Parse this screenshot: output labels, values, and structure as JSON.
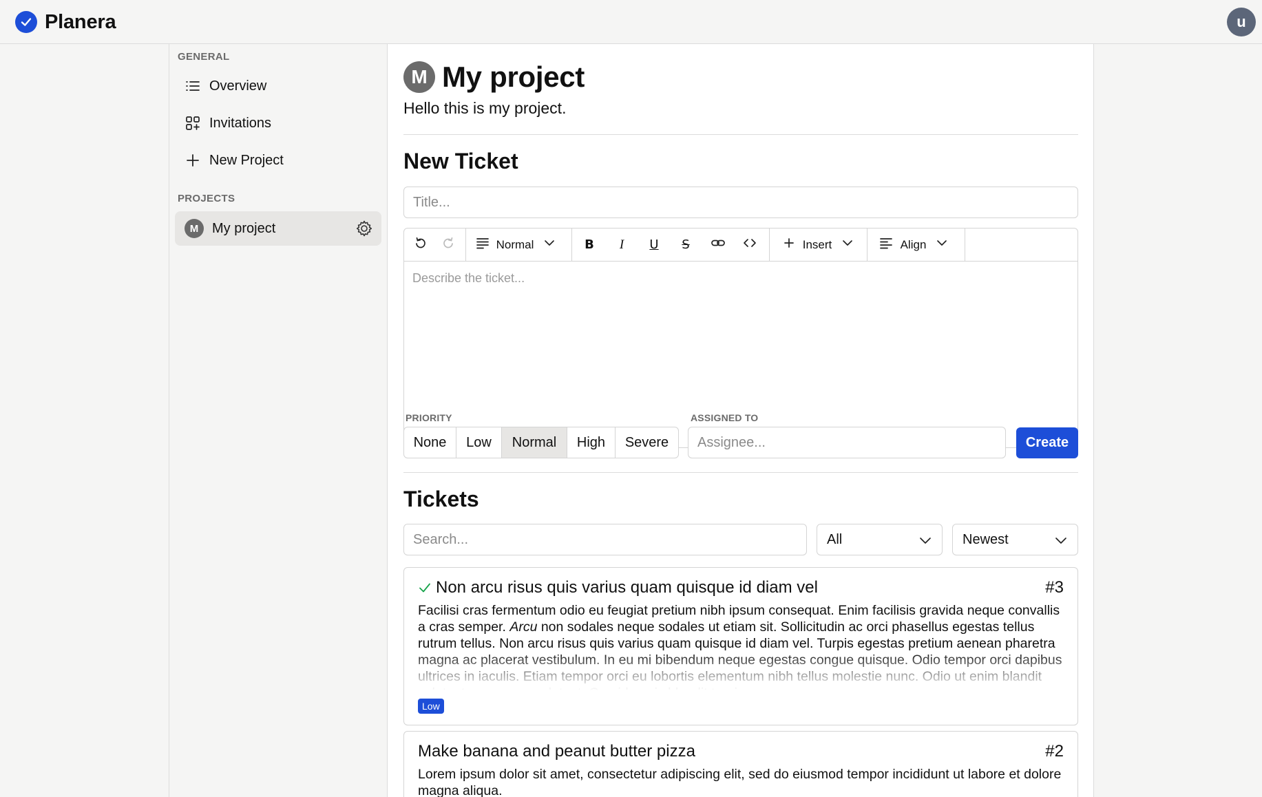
{
  "app": {
    "name": "Planera",
    "user_initial": "u"
  },
  "sidebar": {
    "general_heading": "GENERAL",
    "items": [
      {
        "label": "Overview",
        "icon": "list-icon"
      },
      {
        "label": "Invitations",
        "icon": "grid-plus-icon"
      },
      {
        "label": "New Project",
        "icon": "plus-icon"
      }
    ],
    "projects_heading": "PROJECTS",
    "projects": [
      {
        "initial": "M",
        "label": "My project",
        "active": true
      }
    ]
  },
  "project": {
    "initial": "M",
    "title": "My project",
    "description": "Hello this is my project."
  },
  "new_ticket": {
    "heading": "New Ticket",
    "title_placeholder": "Title...",
    "toolbar": {
      "block_type": "Normal",
      "insert_label": "Insert",
      "align_label": "Align"
    },
    "description_placeholder": "Describe the ticket...",
    "priority_label": "PRIORITY",
    "priorities": [
      "None",
      "Low",
      "Normal",
      "High",
      "Severe"
    ],
    "selected_priority": "Normal",
    "assigned_label": "ASSIGNED TO",
    "assignee_placeholder": "Assignee...",
    "create_label": "Create"
  },
  "tickets": {
    "heading": "Tickets",
    "search_placeholder": "Search...",
    "filter_value": "All",
    "sort_value": "Newest",
    "items": [
      {
        "done": true,
        "title": "Non arcu risus quis varius quam quisque id diam vel",
        "number": "#3",
        "body_part1": "Facilisi cras fermentum odio eu feugiat pretium nibh ipsum consequat. Enim facilisis gravida neque convallis a cras semper. ",
        "body_italic": "Arcu",
        "body_part2": " non sodales neque sodales ut etiam sit. Sollicitudin ac orci phasellus egestas tellus rutrum tellus. Non arcu risus quis varius quam quisque id diam vel. Turpis egestas pretium aenean pharetra magna ac placerat vestibulum. In eu mi bibendum neque egestas congue quisque. Odio tempor orci dapibus ultrices in iaculis. Etiam tempor orci eu lobortis elementum nibh tellus molestie nunc. Odio ut enim blandit volutpat maecenas volutpat. Gravida quis blandit turpis.",
        "priority": "Low"
      },
      {
        "done": false,
        "title": "Make banana and peanut butter pizza",
        "number": "#2",
        "body": "Lorem ipsum dolor sit amet, consectetur adipiscing elit, sed do eiusmod tempor incididunt ut labore et dolore magna aliqua."
      }
    ]
  },
  "colors": {
    "accent": "#1d4ed8",
    "success": "#16a34a",
    "avatar_gray": "#6b6b6b",
    "user_avatar": "#5c6679"
  }
}
